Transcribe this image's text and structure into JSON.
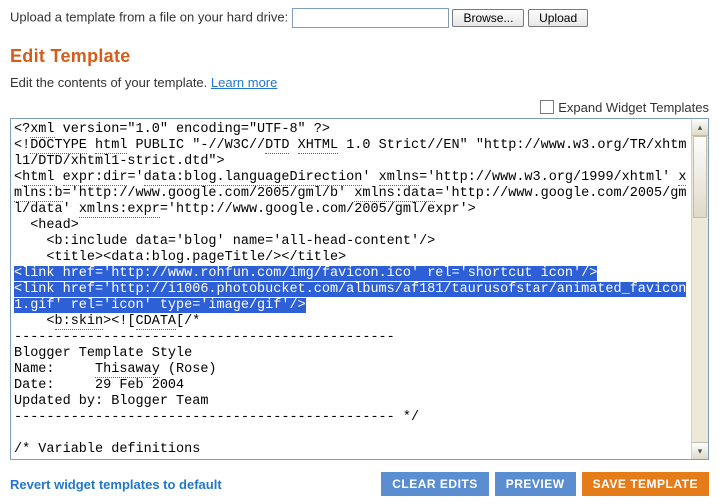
{
  "upload": {
    "label": "Upload a template from a file on your hard drive:",
    "browse": "Browse...",
    "upload_btn": "Upload"
  },
  "section": {
    "title": "Edit Template",
    "desc": "Edit the contents of your template. ",
    "learn_more": "Learn more"
  },
  "expand": {
    "label": "Expand Widget Templates"
  },
  "code": {
    "l1a": "<?",
    "l1b": "xml",
    "l1c": " version=\"1.0\" encoding=\"UTF-8\" ?>",
    "l2a": "<!",
    "l2b": "DOCTYPE",
    "l2c": " ",
    "l2d": "html",
    "l2e": " PUBLIC \"-//W3C//",
    "l2f": "DTD",
    "l2g": " ",
    "l2h": "XHTML",
    "l2i": " 1.0 Strict//EN\" \"http://www.w3.org/TR/xhtml1/DTD/xhtml1-strict.dtd\">",
    "l3a": "<",
    "l3b": "html",
    "l3c": " ",
    "l3d": "expr:dir",
    "l3e": "='",
    "l3f": "data:blog.languageDirection",
    "l3g": "' ",
    "l3h": "xmlns",
    "l3i": "='http://www.w3.org/1999/xhtml' ",
    "l4a": "xmlns:b",
    "l4b": "='http://www.google.com/2005/gml/b' ",
    "l4c": "xmlns:data",
    "l4d": "='http://www.google.com/2005/gml/data' ",
    "l4e": "xmlns:expr",
    "l4f": "='http://www.google.com/2005/gml/expr'>",
    "l5": "  <head>",
    "l6": "    <b:include data='blog' name='all-head-content'/>",
    "l7": "    <title><data:blog.pageTitle/></title>",
    "s1a": "<link ",
    "s1b": "href",
    "s1c": "='http://www.rohfun.com/",
    "s1d": "img",
    "s1e": "/",
    "s1f": "favicon.ico",
    "s1g": "' rel='shortcut icon'/>",
    "s2a": "<link ",
    "s2b": "href",
    "s2c": "='http://i1006.photobucket.com/albums/af181/taurusofstar/animated_favicon1.gif' rel='icon' type='image/gif'/>",
    "l10a": "    <",
    "l10b": "b:skin",
    "l10c": "><![",
    "l10d": "CDATA",
    "l10e": "[/*",
    "l11": "-----------------------------------------------",
    "l12": "Blogger Template Style",
    "l13a": "Name:     ",
    "l13b": "Thisaway",
    "l13c": " (Rose)",
    "l14": "Date:     29 Feb 2004",
    "l15": "Updated by: Blogger Team",
    "l16": "----------------------------------------------- */",
    "l17": "",
    "l18": "/* Variable definitions"
  },
  "footer": {
    "revert": "Revert widget templates to default",
    "clear": "CLEAR EDITS",
    "preview": "PREVIEW",
    "save": "SAVE TEMPLATE"
  }
}
